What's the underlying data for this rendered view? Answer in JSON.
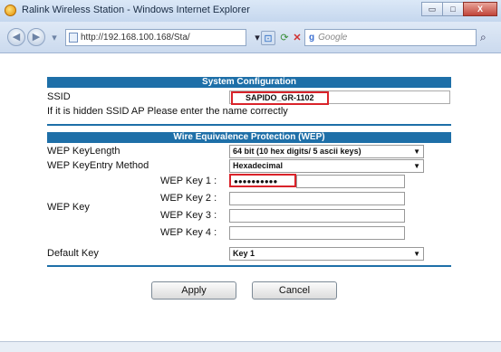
{
  "window": {
    "title": "Ralink Wireless Station - Windows Internet Explorer",
    "buttons": {
      "minimize": "▭",
      "maximize": "□",
      "close": "X"
    }
  },
  "browser": {
    "address": "http://192.168.100.168/Sta/",
    "search_placeholder": "Google",
    "icons": {
      "back": "back-arrow-icon",
      "forward": "forward-arrow-icon",
      "refresh": "refresh-icon",
      "stop": "stop-icon",
      "search_provider": "google-icon"
    }
  },
  "system_config": {
    "header": "System Configuration",
    "ssid_label": "SSID",
    "ssid_value": "SAPIDO_GR-1102",
    "hint": "If it is hidden SSID AP Please enter the name correctly"
  },
  "wep": {
    "header": "Wire Equivalence Protection (WEP)",
    "keylength_label": "WEP KeyLength",
    "keylength_value": "64 bit (10 hex digits/ 5 ascii keys)",
    "entry_method_label": "WEP KeyEntry Method",
    "entry_method_value": "Hexadecimal",
    "wep_key_label": "WEP Key",
    "keys": [
      {
        "label": "WEP Key 1 :",
        "value": "●●●●●●●●●●"
      },
      {
        "label": "WEP Key 2 :",
        "value": ""
      },
      {
        "label": "WEP Key 3 :",
        "value": ""
      },
      {
        "label": "WEP Key 4 :",
        "value": ""
      }
    ],
    "default_key_label": "Default Key",
    "default_key_value": "Key 1"
  },
  "actions": {
    "apply": "Apply",
    "cancel": "Cancel"
  },
  "colors": {
    "header_blue": "#1e6fa8",
    "highlight_red": "#d9232a"
  }
}
